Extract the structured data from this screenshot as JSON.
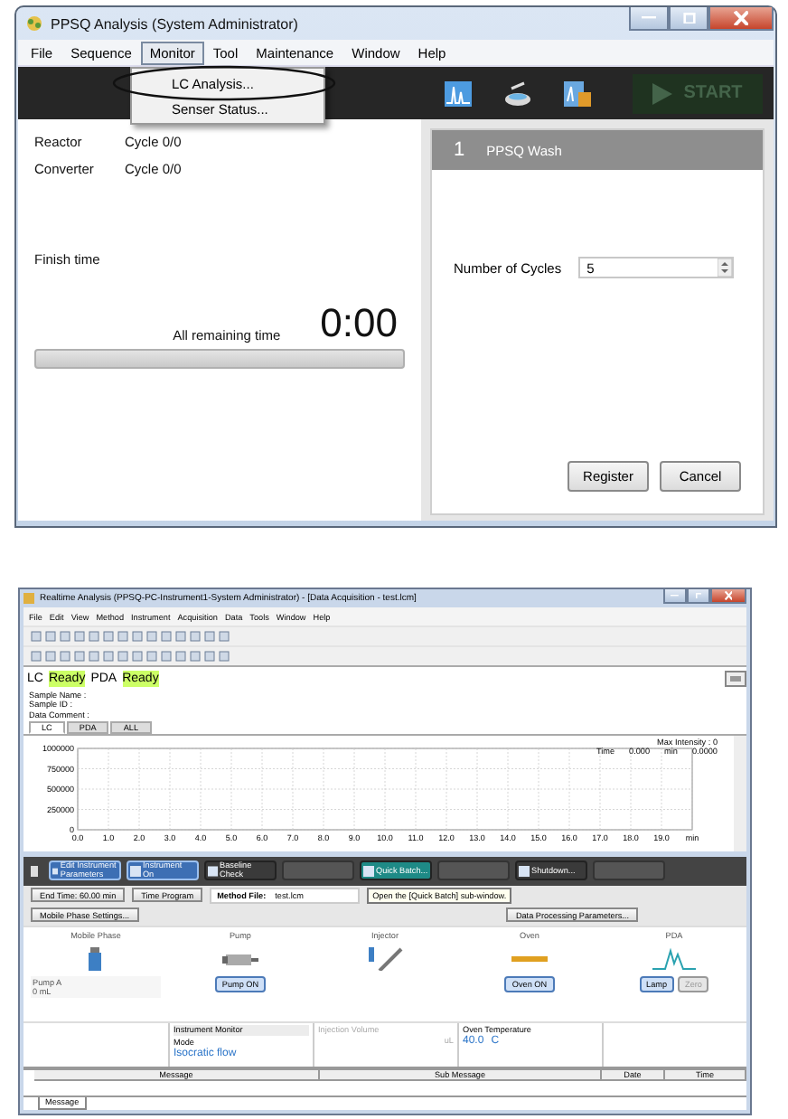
{
  "main_window": {
    "title": "PPSQ Analysis (System Administrator)",
    "menu": [
      {
        "label": "File",
        "selected": false
      },
      {
        "label": "Sequence",
        "selected": false
      },
      {
        "label": "Monitor",
        "selected": true
      },
      {
        "label": "Tool",
        "selected": false
      },
      {
        "label": "Maintenance",
        "selected": false
      },
      {
        "label": "Window",
        "selected": false
      },
      {
        "label": "Help",
        "selected": false
      }
    ],
    "dropdown": [
      {
        "label": "LC Analysis...",
        "circled": true
      },
      {
        "label": "Senser Status...",
        "circled": false
      }
    ],
    "start_button": {
      "label": "START",
      "disabled": true
    },
    "status": [
      {
        "label": "Reactor",
        "value": "Cycle 0/0"
      },
      {
        "label": "Converter",
        "value": "Cycle 0/0"
      }
    ],
    "finish_time": "Finish time",
    "remaining": {
      "label": "All remaining time",
      "value": "0:00",
      "level": 0
    },
    "step": {
      "number": "1",
      "name": "PPSQ Wash",
      "field_label": "Number of Cycles",
      "field_value": "5"
    },
    "buttons": [
      "Register",
      "Cancel"
    ]
  },
  "realtime_window": {
    "title": "Realtime Analysis (PPSQ-PC-Instrument1-System Administrator) - [Data Acquisition - test.lcm]",
    "menu": [
      "File",
      "Edit",
      "View",
      "Method",
      "Instrument",
      "Acquisition",
      "Data",
      "Tools",
      "Window",
      "Help"
    ],
    "status": [
      {
        "label": "LC",
        "value": "Ready"
      },
      {
        "label": "PDA",
        "value": "Ready"
      }
    ],
    "sample_info": [
      "Sample Name :",
      "Sample ID :",
      "Data Comment :"
    ],
    "tabs": [
      {
        "label": "LC",
        "selected": true
      },
      {
        "label": "PDA",
        "selected": false
      },
      {
        "label": "ALL",
        "selected": false
      }
    ],
    "max_intensity": "Max Intensity :  0",
    "readout": [
      "Time",
      "0.000",
      "min",
      "0.0000"
    ],
    "chart_data": {
      "type": "line",
      "grid": true,
      "xlim": [
        0,
        20
      ],
      "ylim": [
        0,
        1000000
      ],
      "xticks": [
        {
          "value": 0,
          "label": "0.0"
        },
        {
          "value": 1,
          "label": "1.0"
        },
        {
          "value": 2,
          "label": "2.0"
        },
        {
          "value": 3,
          "label": "3.0"
        },
        {
          "value": 4,
          "label": "4.0"
        },
        {
          "value": 5,
          "label": "5.0"
        },
        {
          "value": 6,
          "label": "6.0"
        },
        {
          "value": 7,
          "label": "7.0"
        },
        {
          "value": 8,
          "label": "8.0"
        },
        {
          "value": 9,
          "label": "9.0"
        },
        {
          "value": 10,
          "label": "10.0"
        },
        {
          "value": 11,
          "label": "11.0"
        },
        {
          "value": 12,
          "label": "12.0"
        },
        {
          "value": 13,
          "label": "13.0"
        },
        {
          "value": 14,
          "label": "14.0"
        },
        {
          "value": 15,
          "label": "15.0"
        },
        {
          "value": 16,
          "label": "16.0"
        },
        {
          "value": 17,
          "label": "17.0"
        },
        {
          "value": 18,
          "label": "18.0"
        },
        {
          "value": 19,
          "label": "19.0"
        },
        {
          "value": 20,
          "label": "min"
        }
      ],
      "yticks": [
        0,
        250000,
        500000,
        750000,
        1000000
      ]
    },
    "control_buttons": [
      {
        "label": "Edit Instrument Parameters",
        "kind": "active"
      },
      {
        "label": "Instrument On",
        "kind": "active"
      },
      {
        "label": "Baseline Check",
        "kind": "normal"
      },
      {
        "kind": "disabled"
      },
      {
        "label": "Quick Batch...",
        "kind": "hovered"
      },
      {
        "kind": "disabled"
      },
      {
        "label": "Shutdown...",
        "kind": "normal"
      },
      {
        "kind": "disabled"
      }
    ],
    "end_time": "End Time: 60.00 min",
    "time_program": "Time Program",
    "method_file_label": "Method File:",
    "method_file": "test.lcm",
    "tooltip": "Open the [Quick Batch] sub-window.",
    "mobile_phase_settings": "Mobile Phase Settings...",
    "data_processing": "Data Processing Parameters...",
    "units": [
      "Mobile Phase",
      "Pump",
      "Injector",
      "Oven",
      "PDA"
    ],
    "pump_a": {
      "label": "Pump A",
      "value": "0",
      "unit": "mL"
    },
    "unit_buttons": [
      {
        "label": "Pump ON",
        "disabled": false
      },
      {
        "label": "Oven ON",
        "disabled": false
      },
      {
        "label": "Lamp",
        "disabled": false
      },
      {
        "label": "Zero",
        "disabled": true
      }
    ],
    "monitor": {
      "title": "Instrument Monitor",
      "mode_label": "Mode",
      "mode": "Isocratic flow",
      "injection_label": "Injection Volume",
      "injection_unit": "uL",
      "oven_label": "Oven Temperature",
      "oven_value": "40.0",
      "oven_unit": "C"
    },
    "message_columns": [
      "Message",
      "Sub Message",
      "Date",
      "Time"
    ],
    "message_tab": "Message"
  }
}
